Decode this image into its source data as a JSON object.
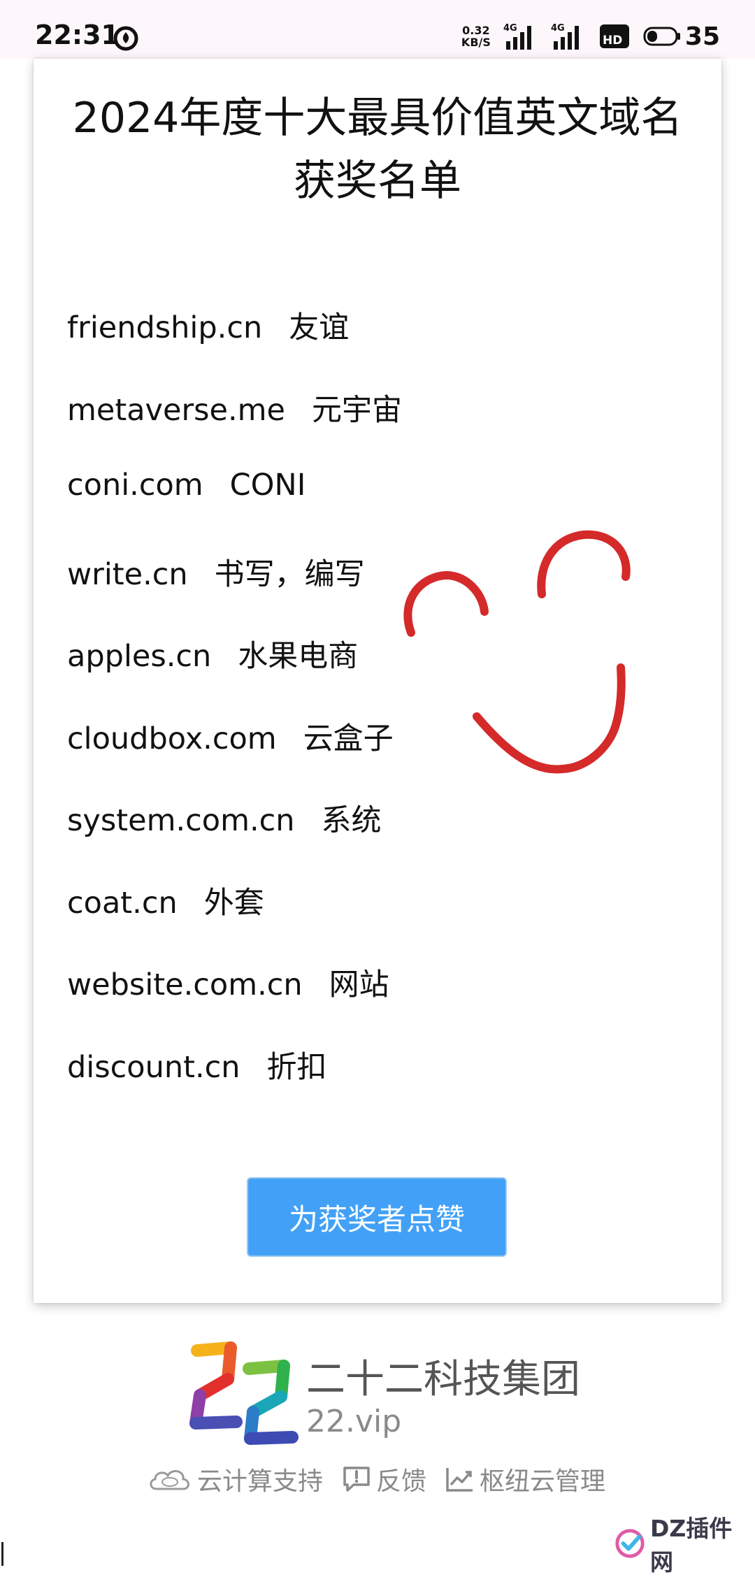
{
  "status_bar": {
    "time": "22:31",
    "net_speed_value": "0.32",
    "net_speed_unit": "KB/S",
    "network_1": "4G",
    "network_2": "4G",
    "battery": "35"
  },
  "card": {
    "title": "2024年度十大最具价值英文域名获奖名单",
    "items": [
      {
        "domain": "friendship.cn",
        "meaning": "友谊"
      },
      {
        "domain": "metaverse.me",
        "meaning": "元宇宙"
      },
      {
        "domain": "coni.com",
        "meaning": "CONI"
      },
      {
        "domain": "write.cn",
        "meaning": "书写，编写"
      },
      {
        "domain": "apples.cn",
        "meaning": "水果电商"
      },
      {
        "domain": "cloudbox.com",
        "meaning": "云盒子"
      },
      {
        "domain": "system.com.cn",
        "meaning": "系统"
      },
      {
        "domain": "coat.cn",
        "meaning": "外套"
      },
      {
        "domain": "website.com.cn",
        "meaning": "网站"
      },
      {
        "domain": "discount.cn",
        "meaning": "折扣"
      }
    ],
    "button_label": "为获奖者点赞"
  },
  "footer": {
    "brand_name": "二十二科技集团",
    "brand_domain": "22.vip",
    "links": [
      {
        "label": "云计算支持",
        "icon": "cloud-icon"
      },
      {
        "label": "反馈",
        "icon": "feedback-icon"
      },
      {
        "label": "枢纽云管理",
        "icon": "trend-chart-icon"
      }
    ]
  },
  "watermark": {
    "text": "DZ插件网"
  },
  "colors": {
    "button": "#42a1f7",
    "doodle": "#d42a2a",
    "footer_text": "#8a8a8a"
  }
}
